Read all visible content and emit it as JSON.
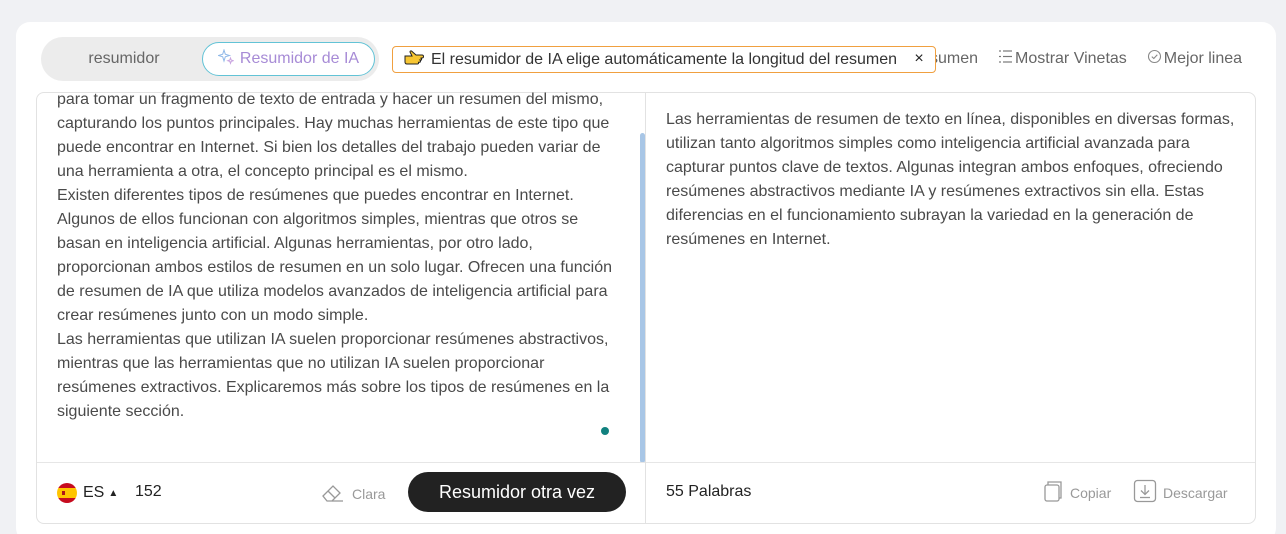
{
  "mode": {
    "basic_label": "resumidor",
    "ai_label": "Resumidor de IA"
  },
  "tooltip": {
    "text": "El resumidor de IA elige automáticamente la longitud del resumen",
    "close": "×"
  },
  "toolbar": {
    "summary_partial": "sumen",
    "bullets_label": "Mostrar Vinetas",
    "best_line_label": "Mejor linea"
  },
  "input": {
    "paragraphs": [
      "para tomar un fragmento de texto de entrada y hacer un resumen del mismo, capturando los puntos principales. Hay muchas herramientas de este tipo que puede encontrar en Internet. Si bien los detalles del trabajo pueden variar de una herramienta a otra, el concepto principal es el mismo.",
      "Existen diferentes tipos de resúmenes que puedes encontrar en Internet. Algunos de ellos funcionan con algoritmos simples, mientras que otros se basan en inteligencia artificial. Algunas herramientas, por otro lado, proporcionan ambos estilos de resumen en un solo lugar. Ofrecen una función de resumen de IA que utiliza modelos avanzados de inteligencia artificial para crear resúmenes junto con un modo simple.",
      "Las herramientas que utilizan IA suelen proporcionar resúmenes abstractivos, mientras que las herramientas que no utilizan IA suelen proporcionar resúmenes extractivos. Explicaremos más sobre los tipos de resúmenes en la siguiente sección."
    ],
    "language": "ES",
    "word_count": "152",
    "clear_label": "Clara",
    "submit_label": "Resumidor otra vez"
  },
  "output": {
    "text": "Las herramientas de resumen de texto en línea, disponibles en diversas formas, utilizan tanto algoritmos simples como inteligencia artificial avanzada para capturar puntos clave de textos. Algunas integran ambos enfoques, ofreciendo resúmenes abstractivos mediante IA y resúmenes extractivos sin ella. Estas diferencias en el funcionamiento subrayan la variedad en la generación de resúmenes en Internet.",
    "word_count_number": "55",
    "word_count_label": "Palabras",
    "copy_label": "Copiar",
    "download_label": "Descargar"
  },
  "colors": {
    "primary_button": "#222222",
    "ai_accent": "#a78bd6",
    "ai_border": "#62c3d6",
    "tooltip_border": "#f0a040",
    "scrollbar": "#a8c6e6",
    "status_dot": "#11817f"
  },
  "icons": {
    "ai_mode": "sparkle-icon",
    "tooltip": "pointing-hand-icon",
    "bullets": "list-icon",
    "best_line": "check-circle-icon",
    "clear": "eraser-icon",
    "copy": "copy-icon",
    "download": "download-icon",
    "language": "spain-flag-icon"
  }
}
